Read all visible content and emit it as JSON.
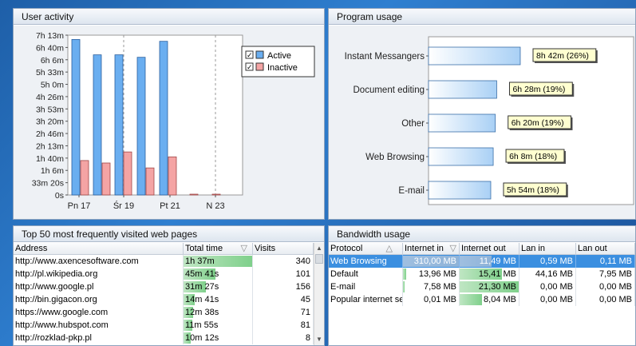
{
  "colors": {
    "active": "#6aaef0",
    "inactive": "#f4a4a4",
    "progbar": "#d6e8fb",
    "green_bar": "#86d494",
    "selected": "#3b8fe0"
  },
  "user_activity": {
    "title": "User activity",
    "chart_data": {
      "type": "bar",
      "categories": [
        "Pn 17",
        "",
        "",
        "",
        "",
        "Sr 19",
        "",
        "",
        "",
        "",
        "Pt 21",
        "",
        "",
        "",
        "",
        "N 23",
        ""
      ],
      "x_tick_labels": [
        "Pn 17",
        "Śr 19",
        "Pt 21",
        "N 23"
      ],
      "y_tick_labels": [
        "7h 13m",
        "6h 40m",
        "6h 6m",
        "5h 33m",
        "5h 0m",
        "4h 26m",
        "3h 53m",
        "3h 20m",
        "2h 46m",
        "2h 13m",
        "1h 40m",
        "1h 6m",
        "33m 20s",
        "0s"
      ],
      "ylim": [
        0,
        26000
      ],
      "series": [
        {
          "name": "Active",
          "values": [
            25300,
            22800,
            22800,
            22400,
            25000,
            0,
            0
          ]
        },
        {
          "name": "Inactive",
          "values": [
            5600,
            5200,
            7000,
            4400,
            6200,
            0,
            0
          ]
        }
      ],
      "legend": [
        "Active",
        "Inactive"
      ],
      "legend_position": "top-right",
      "grid": "vertical dashed"
    }
  },
  "program_usage": {
    "title": "Program usage",
    "chart_data": {
      "type": "bar",
      "orientation": "horizontal",
      "categories": [
        "Instant Messangers",
        "Document editing",
        "Other",
        "Web Browsing",
        "E-mail"
      ],
      "values": [
        31320,
        23280,
        22800,
        22080,
        21240
      ],
      "labels": [
        "8h 42m (26%)",
        "6h 28m (19%)",
        "6h 20m (19%)",
        "6h 8m (18%)",
        "5h 54m (18%)"
      ],
      "xlim": [
        0,
        70000
      ]
    }
  },
  "top_pages": {
    "title": "Top 50 most frequently visited web pages",
    "columns": [
      "Address",
      "Total time",
      "Visits"
    ],
    "sort_glyph": "▽",
    "rows": [
      {
        "address": "http://www.axencesoftware.com",
        "time": "1h 37m",
        "visits": "340",
        "pct": 1.0
      },
      {
        "address": "http://pl.wikipedia.org",
        "time": "45m 41s",
        "visits": "101",
        "pct": 0.47
      },
      {
        "address": "http://www.google.pl",
        "time": "31m 27s",
        "visits": "156",
        "pct": 0.33
      },
      {
        "address": "http://bin.gigacon.org",
        "time": "14m 41s",
        "visits": "45",
        "pct": 0.16
      },
      {
        "address": "https://www.google.com",
        "time": "12m 38s",
        "visits": "71",
        "pct": 0.14
      },
      {
        "address": "http://www.hubspot.com",
        "time": "11m 55s",
        "visits": "81",
        "pct": 0.13
      },
      {
        "address": "http://rozklad-pkp.pl",
        "time": "10m 12s",
        "visits": "8",
        "pct": 0.11
      }
    ]
  },
  "bandwidth": {
    "title": "Bandwidth usage",
    "columns": [
      "Protocol",
      "Internet in",
      "Internet out",
      "Lan in",
      "Lan out"
    ],
    "sort_glyph_asc": "△",
    "sort_glyph_desc": "▽",
    "rows": [
      {
        "protocol": "Web Browsing",
        "in": "310,00 MB",
        "out": "11,49 MB",
        "lanin": "0,59 MB",
        "lanout": "0,11 MB",
        "in_pct": 1.0,
        "out_pct": 0.54
      },
      {
        "protocol": "Default",
        "in": "13,96 MB",
        "out": "15,41 MB",
        "lanin": "44,16 MB",
        "lanout": "7,95 MB",
        "in_pct": 0.05,
        "out_pct": 0.72
      },
      {
        "protocol": "E-mail",
        "in": "7,58 MB",
        "out": "21,30 MB",
        "lanin": "0,00 MB",
        "lanout": "0,00 MB",
        "in_pct": 0.03,
        "out_pct": 1.0
      },
      {
        "protocol": "Popular internet se",
        "in": "0,01 MB",
        "out": "8,04 MB",
        "lanin": "0,00 MB",
        "lanout": "0,00 MB",
        "in_pct": 0.0,
        "out_pct": 0.38
      }
    ]
  }
}
